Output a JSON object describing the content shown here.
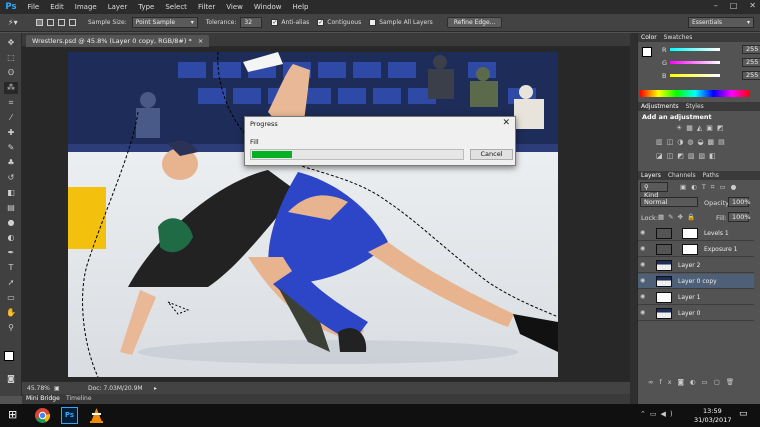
{
  "app": {
    "logo": "Ps",
    "accent": "#31a8ff"
  },
  "menu": [
    "File",
    "Edit",
    "Image",
    "Layer",
    "Type",
    "Select",
    "Filter",
    "View",
    "Window",
    "Help"
  ],
  "window_controls": {
    "minimize": "–",
    "maximize": "□",
    "close": "✕"
  },
  "options": {
    "sample_size_label": "Sample Size:",
    "sample_size_value": "Point Sample",
    "tolerance_label": "Tolerance:",
    "tolerance_value": "32",
    "anti_alias": "Anti-alias",
    "contiguous": "Contiguous",
    "sample_all_layers": "Sample All Layers",
    "refine_edge": "Refine Edge...",
    "workspace": "Essentials"
  },
  "document": {
    "tab_title": "Wrestlers.psd @ 45.8% (Layer 0 copy, RGB/8#) *",
    "close": "×"
  },
  "status": {
    "zoom": "45.78%",
    "doc_size": "Doc: 7.03M/20.9M"
  },
  "bottom_tabs": {
    "mini_bridge": "Mini Bridge",
    "timeline": "Timeline"
  },
  "color_panel": {
    "tabs": [
      "Color",
      "Swatches"
    ],
    "channels": [
      {
        "label": "R",
        "value": "255"
      },
      {
        "label": "G",
        "value": "255"
      },
      {
        "label": "B",
        "value": "255"
      }
    ]
  },
  "adjustments_panel": {
    "tabs": [
      "Adjustments",
      "Styles"
    ],
    "title": "Add an adjustment"
  },
  "layers_panel": {
    "tabs": [
      "Layers",
      "Channels",
      "Paths"
    ],
    "kind": "Kind",
    "blend_mode": "Normal",
    "opacity_label": "Opacity:",
    "opacity_value": "100%",
    "lock_label": "Lock:",
    "fill_label": "Fill:",
    "fill_value": "100%",
    "layers": [
      {
        "name": "Levels 1",
        "selected": false
      },
      {
        "name": "Exposure 1",
        "selected": false
      },
      {
        "name": "Layer 2",
        "selected": false
      },
      {
        "name": "Layer 0 copy",
        "selected": true
      },
      {
        "name": "Layer 1",
        "selected": false
      },
      {
        "name": "Layer 0",
        "selected": false
      }
    ],
    "footer_icons": [
      "link-icon",
      "fx-icon",
      "mask-icon",
      "adjustment-icon",
      "folder-icon",
      "new-layer-icon",
      "trash-icon"
    ]
  },
  "progress_dialog": {
    "title": "Progress",
    "close": "✕",
    "label": "Fill",
    "progress": 0.19,
    "cancel": "Cancel",
    "bar_color": "#06b025"
  },
  "taskbar": {
    "time": "13:59",
    "date": "31/03/2017",
    "start": "⊞"
  }
}
